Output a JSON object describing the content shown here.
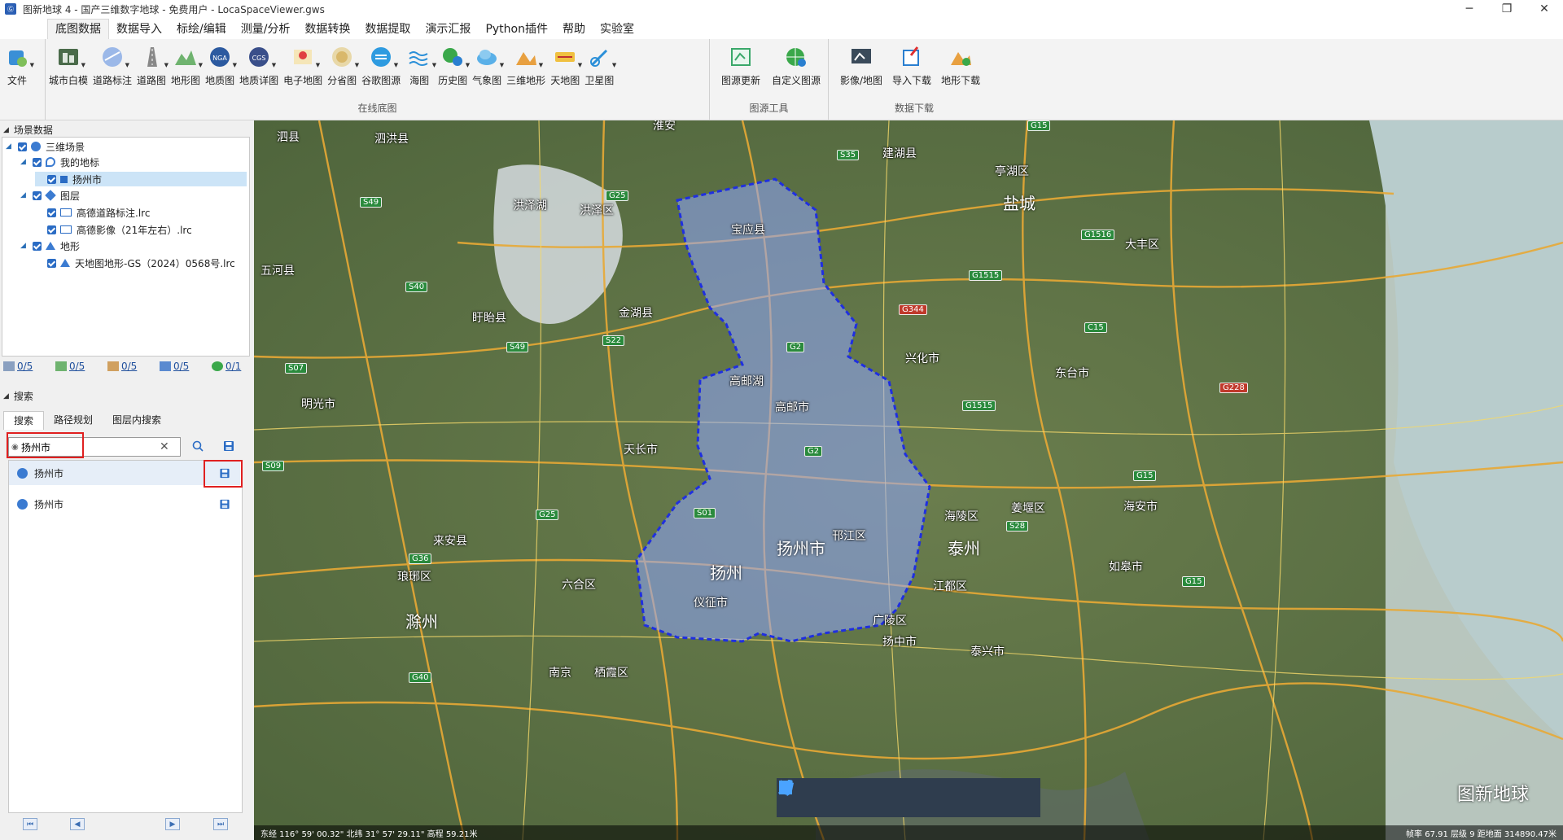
{
  "window": {
    "title": "图新地球 4 - 国产三维数字地球 - 免费用户 - LocaSpaceViewer.gws",
    "minimize": "─",
    "maximize": "❐",
    "close": "✕"
  },
  "menu": [
    "底图数据",
    "数据导入",
    "标绘/编辑",
    "测量/分析",
    "数据转换",
    "数据提取",
    "演示汇报",
    "Python插件",
    "帮助",
    "实验室"
  ],
  "ribbon": {
    "file_label": "文件",
    "online_group": {
      "name": "在线底图",
      "items": [
        "城市白模",
        "道路标注",
        "道路图",
        "地形图",
        "地质图",
        "地质详图",
        "电子地图",
        "分省图",
        "谷歌图源",
        "海图",
        "历史图",
        "气象图",
        "三维地形",
        "天地图",
        "卫星图"
      ]
    },
    "source_group": {
      "name": "图源工具",
      "items": [
        "图源更新",
        "自定义图源"
      ]
    },
    "download_group": {
      "name": "数据下载",
      "items": [
        "影像/地图",
        "导入下载",
        "地形下载"
      ]
    }
  },
  "scene": {
    "header": "场景数据",
    "tree": [
      {
        "label": "三维场景",
        "level": 0
      },
      {
        "label": "我的地标",
        "level": 1
      },
      {
        "label": "扬州市",
        "level": 2,
        "selected": true
      },
      {
        "label": "图层",
        "level": 1
      },
      {
        "label": "高德道路标注.lrc",
        "level": 2
      },
      {
        "label": "高德影像（21年左右）.lrc",
        "level": 2
      },
      {
        "label": "地形",
        "level": 1
      },
      {
        "label": "天地图地形-GS（2024）0568号.lrc",
        "level": 2
      }
    ],
    "stats": [
      "0/5",
      "0/5",
      "0/5",
      "0/5",
      "0/1"
    ]
  },
  "search": {
    "header": "搜索",
    "tabs": [
      "搜索",
      "路径规划",
      "图层内搜索"
    ],
    "query": "扬州市",
    "results": [
      "扬州市",
      "扬州市"
    ]
  },
  "map": {
    "labels": [
      "泗县",
      "泗洪县",
      "淮安",
      "洪泽湖",
      "洪泽区",
      "盱眙县",
      "金湖县",
      "宝应县",
      "建湖县",
      "亭湖区",
      "盐城",
      "大丰区",
      "兴化市",
      "东台市",
      "高邮市",
      "高邮湖",
      "天长市",
      "明光市",
      "来安县",
      "滁州",
      "六合区",
      "南京",
      "栖霞区",
      "仪征市",
      "扬州市",
      "邗江区",
      "广陵区",
      "江都区",
      "泰州",
      "海陵区",
      "姜堰区",
      "扬中市",
      "如皋市",
      "海安市",
      "泰兴市",
      "五河县",
      "琅琊区",
      "扬州"
    ],
    "shields": [
      "G15",
      "S35",
      "G25",
      "S49",
      "S40",
      "G1516",
      "G1515",
      "G344",
      "G2",
      "G1515",
      "C15",
      "S22",
      "S49",
      "S07",
      "S09",
      "G36",
      "G25",
      "S01",
      "G2",
      "G40",
      "G15",
      "G228",
      "S28",
      "G15"
    ],
    "status_left": "东经 116° 59' 00.32\"  北纬 31° 57' 29.11\"   高程 59.21米",
    "status_right": "帧率 67.91  层级 9  距地面 314890.47米",
    "watermark": "图新地球"
  },
  "colors": {
    "accent": "#2b6cc4",
    "region_fill": "#8fa6ff",
    "region_border": "#1f2fe0",
    "highlight": "#e02020"
  }
}
